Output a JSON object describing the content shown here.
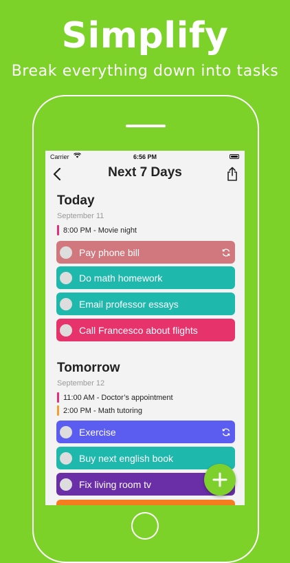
{
  "promo": {
    "headline": "Simplify",
    "subheadline": "Break everything down into tasks"
  },
  "status_bar": {
    "carrier": "Carrier",
    "time": "6:56 PM"
  },
  "nav": {
    "title": "Next 7 Days"
  },
  "sections": [
    {
      "title": "Today",
      "date": "September 11",
      "events": [
        {
          "text": "8:00 PM - Movie night",
          "color": "#e0307a"
        }
      ],
      "tasks": [
        {
          "label": "Pay phone bill",
          "color": "#d1787e",
          "repeat": true
        },
        {
          "label": "Do math homework",
          "color": "#1fb8ad",
          "repeat": false
        },
        {
          "label": "Email professor essays",
          "color": "#1fb8ad",
          "repeat": false
        },
        {
          "label": "Call Francesco about flights",
          "color": "#e7336c",
          "repeat": false
        }
      ]
    },
    {
      "title": "Tomorrow",
      "date": "September 12",
      "events": [
        {
          "text": "11:00 AM - Doctor’s appointment",
          "color": "#e0307a"
        },
        {
          "text": "2:00 PM - Math tutoring",
          "color": "#f0a030"
        }
      ],
      "tasks": [
        {
          "label": "Exercise",
          "color": "#5b5cf0",
          "repeat": true
        },
        {
          "label": "Buy next english book",
          "color": "#1fb8ad",
          "repeat": false
        },
        {
          "label": "Fix living room tv",
          "color": "#6a2ea6",
          "repeat": false
        }
      ]
    }
  ],
  "colors": {
    "background": "#7dd22a",
    "fab": "#7ed12c",
    "partial_task": "#f57c1f"
  }
}
